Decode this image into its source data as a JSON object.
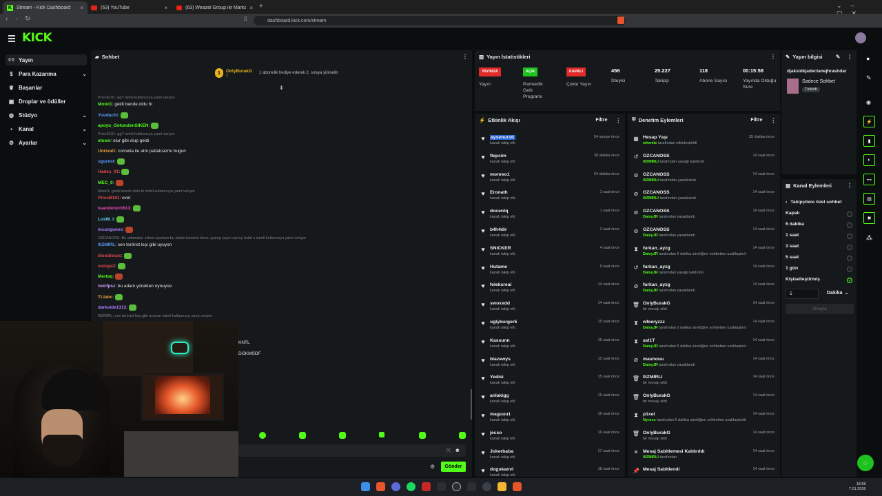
{
  "browser": {
    "tabs": [
      "Stream - Kick Dashboard",
      "(63) YouTube",
      "(63) Weazel Group ile Markanızı Zirve"
    ],
    "url": "dashboard.kick.com/stream"
  },
  "logo": "KICK",
  "sidebar": {
    "items": [
      {
        "label": "Yayın",
        "icon": "broadcast-icon"
      },
      {
        "label": "Para Kazanma",
        "icon": "money-icon",
        "expand": true
      },
      {
        "label": "Başarılar",
        "icon": "trophy-icon"
      },
      {
        "label": "Droplar ve ödüller",
        "icon": "gift-icon"
      },
      {
        "label": "Stüdyo",
        "icon": "palette-icon",
        "expand": true
      },
      {
        "label": "Kanal",
        "icon": "user-icon",
        "expand": true
      },
      {
        "label": "Ayarlar",
        "icon": "gear-icon",
        "expand": true
      }
    ]
  },
  "chat": {
    "title": "Sohbet",
    "pinned_user": "OnlyBurakG",
    "pinned_count": "1",
    "pinned_text": "1 abonelik hediye ederek 2. sıraya yükselin",
    "messages": [
      {
        "sys": "Price6191: gg? isimli kullanıcıya yanıt veriyor"
      },
      {
        "user": "Momi1",
        "color": "#53fc18",
        "text": ": geldi bende oldu bi"
      },
      {
        "user": "Yuudachi",
        "color": "#5b9bff",
        "text": ":",
        "emote": true
      },
      {
        "user": "apoyu_GotundenSIKEN",
        "color": "#53fc18",
        "text": ":",
        "emote": true
      },
      {
        "sys": "Price6191: gg? isimli kullanıcıya yanıt veriyor"
      },
      {
        "user": "etosw",
        "color": "#53fc18",
        "text": ": olur gibi olup geldi"
      },
      {
        "user": "Unrival1",
        "color": "#e8a13a",
        "text": ": cornelia ile atm patlatcazmı bugun"
      },
      {
        "user": "ugurest",
        "color": "#5b9bff",
        "text": ":",
        "emote": true
      },
      {
        "user": "Hades_01",
        "color": "#e04a4a",
        "text": ":",
        "emote": true
      },
      {
        "user": "MEC_0",
        "color": "#53fc18",
        "text": ":",
        "emote": true
      },
      {
        "sys": "Momi1: geldi bende oldu bi isimli kullanıcıya yanıt veriyor"
      },
      {
        "user": "PriceB191",
        "color": "#e04a4a",
        "text": ": evet"
      },
      {
        "user": "kaandemir0613",
        "color": "#e04ab0",
        "text": ":",
        "emote": true
      },
      {
        "user": "LusW_l",
        "color": "#5bd6ff",
        "text": ":",
        "emote": true
      },
      {
        "user": "mcangunes",
        "color": "#b07cff",
        "text": ":",
        "emote": true
      },
      {
        "sys": "OZCANOSS: Bu adamdan erken uyudum bu adam benden önce uyanıp yayın açmış helal o isimli kullanıcıya yanıt veriyor"
      },
      {
        "user": "0IZMIRL",
        "color": "#5b9bff",
        "text": ": sen terörist leşi gibi uyuyon"
      },
      {
        "user": "bloodiesss",
        "color": "#e04a4a",
        "text": ":",
        "emote": true
      },
      {
        "user": "sezaya2",
        "color": "#e04a4a",
        "text": ":",
        "emote": true
      },
      {
        "user": "Mertaq",
        "color": "#53fc18",
        "text": ":",
        "emote": true
      },
      {
        "user": "noirfpsz",
        "color": "#d2a0ff",
        "text": ": bu adam yürekten oynuyoe"
      },
      {
        "user": "TLtabc",
        "color": "#e8a13a",
        "text": ":",
        "emote": true
      },
      {
        "user": "darkside1312",
        "color": "#b07cff",
        "text": ":",
        "emote": true
      },
      {
        "sys": "0IZMIRL: sen terörist leşi gibi uyuyon isimli kullanıcıya yanıt veriyor"
      }
    ],
    "overflow": [
      "KNTL",
      "DGKMSDF"
    ],
    "send_label": "Gönder"
  },
  "stats": {
    "title": "Yayın İstatistikleri",
    "items": [
      {
        "badge": "YAYINDA",
        "badge_color": "#e02b2b",
        "label": "Yayın"
      },
      {
        "badge": "AÇIK",
        "badge_color": "#1ec21e",
        "label": "Partnerlik Gelir Programı"
      },
      {
        "badge": "KAPALI",
        "badge_color": "#e02b2b",
        "label": "Çoklu Yayın"
      },
      {
        "value": "456",
        "label": "İzleyici"
      },
      {
        "value": "25.227",
        "label": "Takipçi"
      },
      {
        "value": "118",
        "label": "Abone Sayısı"
      },
      {
        "value": "00:15:58",
        "label": "Yayında Olduğu Süre"
      }
    ]
  },
  "activity": {
    "title": "Etkinlik Akışı",
    "filter": "Filtre",
    "rows": [
      {
        "name": "aysenursti",
        "sub": "kanalı takip etti",
        "time": "54 saniye önce",
        "hl": true
      },
      {
        "name": "flepcim",
        "sub": "kanalı takip etti",
        "time": "38 dakika önce"
      },
      {
        "name": "monreo1",
        "sub": "kanalı takip etti",
        "time": "54 dakika önce"
      },
      {
        "name": "Eronath",
        "sub": "kanalı takip etti",
        "time": "1 saat önce"
      },
      {
        "name": "docentq",
        "sub": "kanalı takip etti",
        "time": "1 saat önce"
      },
      {
        "name": "b4h4dir",
        "sub": "kanalı takip etti",
        "time": "2 saat önce"
      },
      {
        "name": "SNICKER",
        "sub": "kanalı takip etti",
        "time": "4 saat önce"
      },
      {
        "name": "Hutame",
        "sub": "kanalı takip etti",
        "time": "9 saat önce"
      },
      {
        "name": "feleksreal",
        "sub": "kanalı takip etti",
        "time": "14 saat önce"
      },
      {
        "name": "swoxxdd",
        "sub": "kanalı takip etti",
        "time": "14 saat önce"
      },
      {
        "name": "uglyburger5",
        "sub": "kanalı takip etti",
        "time": "15 saat önce"
      },
      {
        "name": "Kassunn",
        "sub": "kanalı takip etti",
        "time": "15 saat önce"
      },
      {
        "name": "blazewys",
        "sub": "kanalı takip etti",
        "time": "15 saat önce"
      },
      {
        "name": "Yedisi",
        "sub": "kanalı takip etti",
        "time": "15 saat önce"
      },
      {
        "name": "anlakigg",
        "sub": "kanalı takip etti",
        "time": "15 saat önce"
      },
      {
        "name": "maguuu1",
        "sub": "kanalı takip etti",
        "time": "16 saat önce"
      },
      {
        "name": "jecso",
        "sub": "kanalı takip etti",
        "time": "16 saat önce"
      },
      {
        "name": "Jokerbaba",
        "sub": "kanalı takip etti",
        "time": "17 saat önce"
      },
      {
        "name": "dogukanvl",
        "sub": "kanalı takip etti",
        "time": "18 saat önce"
      }
    ]
  },
  "moderation": {
    "title": "Denetim Eylemleri",
    "filter": "Filtre",
    "rows": [
      {
        "icon": "calendar-icon",
        "glyph": "▦",
        "name": "Hesap Yaşı",
        "actor": "whenite",
        "sub": "tarafından etkinleştirildi",
        "time": "35 dakika önce"
      },
      {
        "icon": "undo-icon",
        "glyph": "↺",
        "name": "OZCANOSS",
        "actor": "0IZMIRLI",
        "sub": "tarafından yasağı kaldırıldı",
        "time": "14 saat önce"
      },
      {
        "icon": "ban-icon",
        "glyph": "⊘",
        "name": "OZCANOSS",
        "actor": "0IZMIRLI",
        "sub": "tarafından yasaklandı",
        "time": "14 saat önce"
      },
      {
        "icon": "ban-icon",
        "glyph": "⊘",
        "name": "OZCANOSS",
        "actor": "0IZMIRLI",
        "sub": "tarafından yasaklandı",
        "time": "14 saat önce"
      },
      {
        "icon": "ban-icon",
        "glyph": "⊘",
        "name": "OZCANOSS",
        "actor": "DaisyJR",
        "sub": "tarafından yasaklandı",
        "time": "14 saat önce"
      },
      {
        "icon": "ban-icon",
        "glyph": "⊘",
        "name": "OZCANOSS",
        "actor": "DaisyJR",
        "sub": "tarafından yasaklandı",
        "time": "14 saat önce"
      },
      {
        "icon": "hourglass-icon",
        "glyph": "⧗",
        "name": "furkan_ayzg",
        "actor": "DaisyJR",
        "sub": "tarafından 5 dakika süreliğine sohbetten uzaklaştırıldı",
        "time": "14 saat önce"
      },
      {
        "icon": "undo-icon",
        "glyph": "↺",
        "name": "furkan_ayzg",
        "actor": "DaisyJR",
        "sub": "tarafından yasağı kaldırıldı",
        "time": "14 saat önce"
      },
      {
        "icon": "ban-icon",
        "glyph": "⊘",
        "name": "furkan_ayzg",
        "actor": "DaisyJR",
        "sub": "tarafından yasaklandı",
        "time": "14 saat önce"
      },
      {
        "icon": "trash-icon",
        "glyph": "🗑",
        "name": "OnlyBurakG",
        "actor": "",
        "sub": "bir mesajı sildi",
        "time": "14 saat önce"
      },
      {
        "icon": "hourglass-icon",
        "glyph": "⧗",
        "name": "wfeeryzzz",
        "actor": "DaisyJR",
        "sub": "tarafından 5 dakika süreliğine sohbetten uzaklaştırıldı",
        "time": "14 saat önce"
      },
      {
        "icon": "hourglass-icon",
        "glyph": "⧗",
        "name": "asl1T",
        "actor": "DaisyJR",
        "sub": "tarafından 5 dakika süreliğine sohbetten uzaklaştırıldı",
        "time": "14 saat önce"
      },
      {
        "icon": "ban-icon",
        "glyph": "⊘",
        "name": "mashouu",
        "actor": "DaisyJR",
        "sub": "tarafından yasaklandı",
        "time": "14 saat önce"
      },
      {
        "icon": "trash-icon",
        "glyph": "🗑",
        "name": "0IZMIRLI",
        "actor": "",
        "sub": "bir mesajı sildi",
        "time": "14 saat önce"
      },
      {
        "icon": "trash-icon",
        "glyph": "🗑",
        "name": "OnlyBurakG",
        "actor": "",
        "sub": "bir mesajı sildi",
        "time": "14 saat önce"
      },
      {
        "icon": "hourglass-icon",
        "glyph": "⧗",
        "name": "p1xel",
        "actor": "Nyross",
        "sub": "tarafından 5 dakika süreliğine sohbetten uzaklaştırıldı",
        "time": "14 saat önce"
      },
      {
        "icon": "trash-icon",
        "glyph": "🗑",
        "name": "OnlyBurakG",
        "actor": "",
        "sub": "bir mesajı sildi",
        "time": "14 saat önce"
      },
      {
        "icon": "unpin-icon",
        "glyph": "✕",
        "name": "Mesaj Sabitlemesi Kaldırıldı",
        "actor": "0IZMIRLI",
        "sub": "tarafından",
        "time": "14 saat önce"
      },
      {
        "icon": "pin-icon",
        "glyph": "📌",
        "name": "Mesaj Sabitlendi",
        "actor": "",
        "sub": "",
        "time": "14 saat önce"
      }
    ]
  },
  "stream_info": {
    "title": "Yayın bilgisi",
    "stream_title": "djaksidkjadeclanejhrashdar",
    "category": "Sadece Sohbet",
    "language": "Turkish"
  },
  "channel_actions": {
    "title": "Kanal Eylemleri",
    "subtitle": "Takipçilere özel sohbet",
    "options": [
      "Kapalı",
      "6 dakika",
      "1 saat",
      "3 saat",
      "5 saat",
      "1 gün",
      "Kişiselleştirmiş"
    ],
    "selected": 6,
    "input_value": "5",
    "unit": "Dakika",
    "confirm": "Onayla"
  },
  "taskbar": {
    "time": "18:58",
    "date": "7.01.2026"
  },
  "colors": {
    "accent": "#53fc18",
    "panel": "#16191b",
    "bg": "#0b0e0f"
  }
}
